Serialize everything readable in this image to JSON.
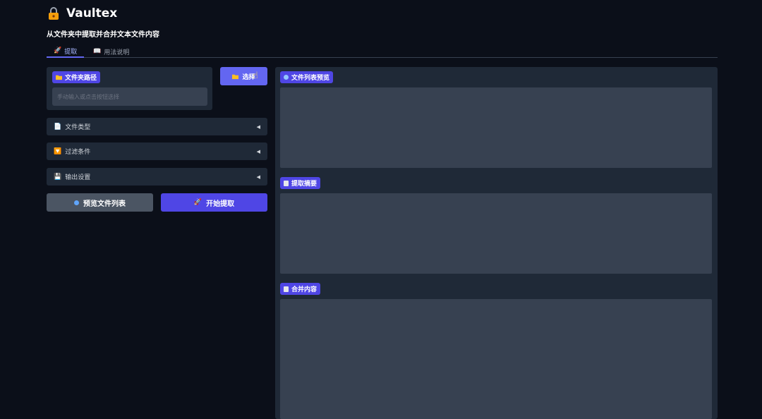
{
  "app": {
    "title": "Vaultex",
    "subtitle": "从文件夹中提取并合并文本文件内容",
    "icon": "lock-icon"
  },
  "tabs": [
    {
      "label": "提取",
      "icon": "rocket-icon",
      "active": true
    },
    {
      "label": "用法说明",
      "icon": "book-icon",
      "active": false
    }
  ],
  "folder": {
    "label": "文件夹路径",
    "placeholder": "手动输入或点击按钮选择",
    "select_button": "选择"
  },
  "accordions": [
    {
      "label": "文件类型",
      "icon": "document-icon"
    },
    {
      "label": "过滤条件",
      "icon": "filter-icon"
    },
    {
      "label": "输出设置",
      "icon": "save-icon"
    }
  ],
  "actions": {
    "preview_label": "预览文件列表",
    "extract_label": "开始提取"
  },
  "outputs": {
    "file_list_label": "文件列表预览",
    "summary_label": "提取摘要",
    "merged_label": "合并内容"
  },
  "colors": {
    "background": "#0b0f19",
    "panel": "#1f2937",
    "input": "#374151",
    "accent": "#4f46e5",
    "accent_light": "#6366f1",
    "secondary_button": "#4b5563"
  }
}
